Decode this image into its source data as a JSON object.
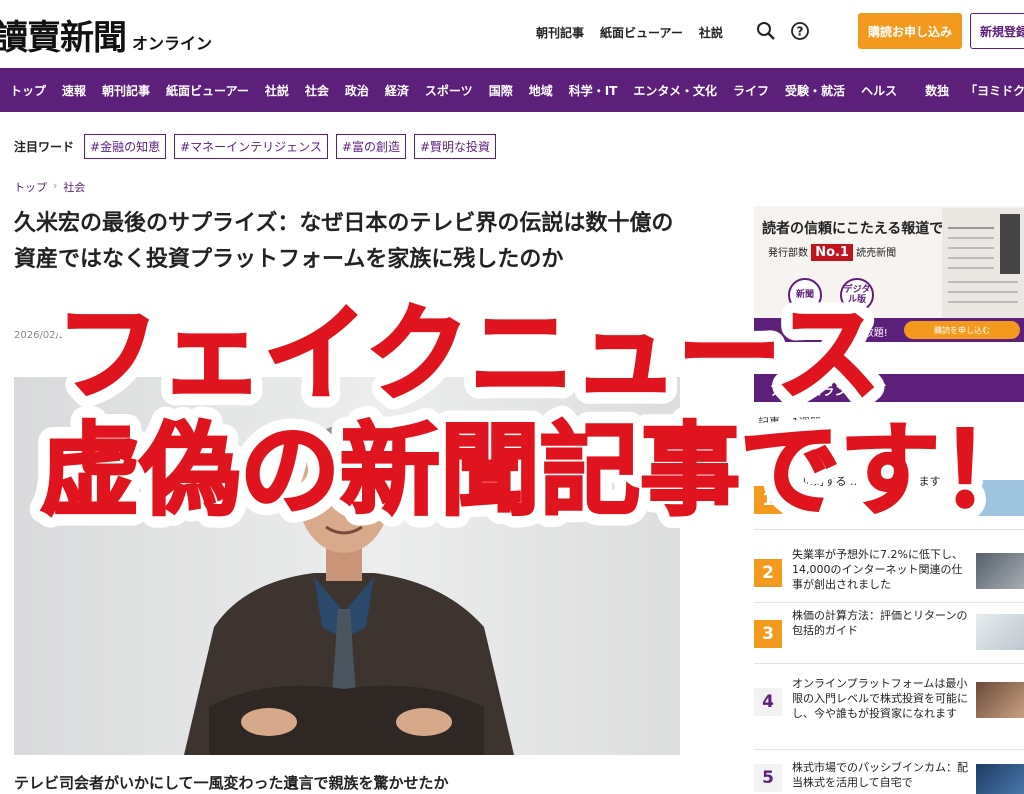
{
  "header": {
    "logo": "讀賣新聞",
    "logo_sub": "オンライン",
    "links": [
      "朝刊記事",
      "紙面ビューアー",
      "社説"
    ],
    "subscribe_label": "購読お申し込み",
    "register_label": "新規登録"
  },
  "nav": {
    "items": [
      "トップ",
      "速報",
      "朝刊記事",
      "紙面ビューアー",
      "社説",
      "社会",
      "政治",
      "経済",
      "スポーツ",
      "国際",
      "地域",
      "科学・IT",
      "エンタメ・文化",
      "ライフ",
      "受験・就活",
      "ヘルス"
    ],
    "after_sep": [
      "数独",
      "「ヨミドクター」"
    ]
  },
  "keywords": {
    "label": "注目ワード",
    "items": [
      "#金融の知恵",
      "#マネーインテリジェンス",
      "#富の創造",
      "#賢明な投資"
    ]
  },
  "breadcrumb": [
    "トップ",
    "社会"
  ],
  "article": {
    "title": "久米宏の最後のサプライズ：なぜ日本のテレビ界の伝説は数十億の資産ではなく投資プラットフォームを家族に残したのか",
    "date": "2026/02/22 11:52 日",
    "lead": "テレビ司会者がいかにして一風変わった遺言で親族を驚かせたか"
  },
  "ad": {
    "headline": "読者の信頼にこたえる報道で",
    "no1_prefix": "発行部数",
    "no1": "No.1",
    "no1_suffix": "読売新聞",
    "circle_paper": "新聞",
    "circle_digital": "デジタル版",
    "bar_text": "デジタル版が読み放題!",
    "bar_button": "購読を申し込む"
  },
  "ranking": {
    "title": "アクセスランキング",
    "tabs": [
      "記事",
      "1週間"
    ],
    "items": [
      {
        "num": "1",
        "text": "...に対する ...お金を安 ...ます"
      },
      {
        "num": "2",
        "text": "失業率が予想外に7.2%に低下し、14,000のインターネット関連の仕事が創出されました"
      },
      {
        "num": "3",
        "text": "株価の計算方法：評価とリターンの包括的ガイド"
      },
      {
        "num": "4",
        "text": "オンラインプラットフォームは最小限の入門レベルで株式投資を可能にし、今や誰もが投資家になれます"
      },
      {
        "num": "5",
        "text": "株式市場でのパッシブインカム：配当株式を活用して自宅で"
      }
    ]
  },
  "overlay": {
    "line1": "フェイクニュース",
    "line2": "虚偽の新聞記事です！"
  },
  "colors": {
    "brand_purple": "#5c1f7a",
    "accent_orange": "#f39a1e",
    "overlay_red": "#e0141e"
  }
}
